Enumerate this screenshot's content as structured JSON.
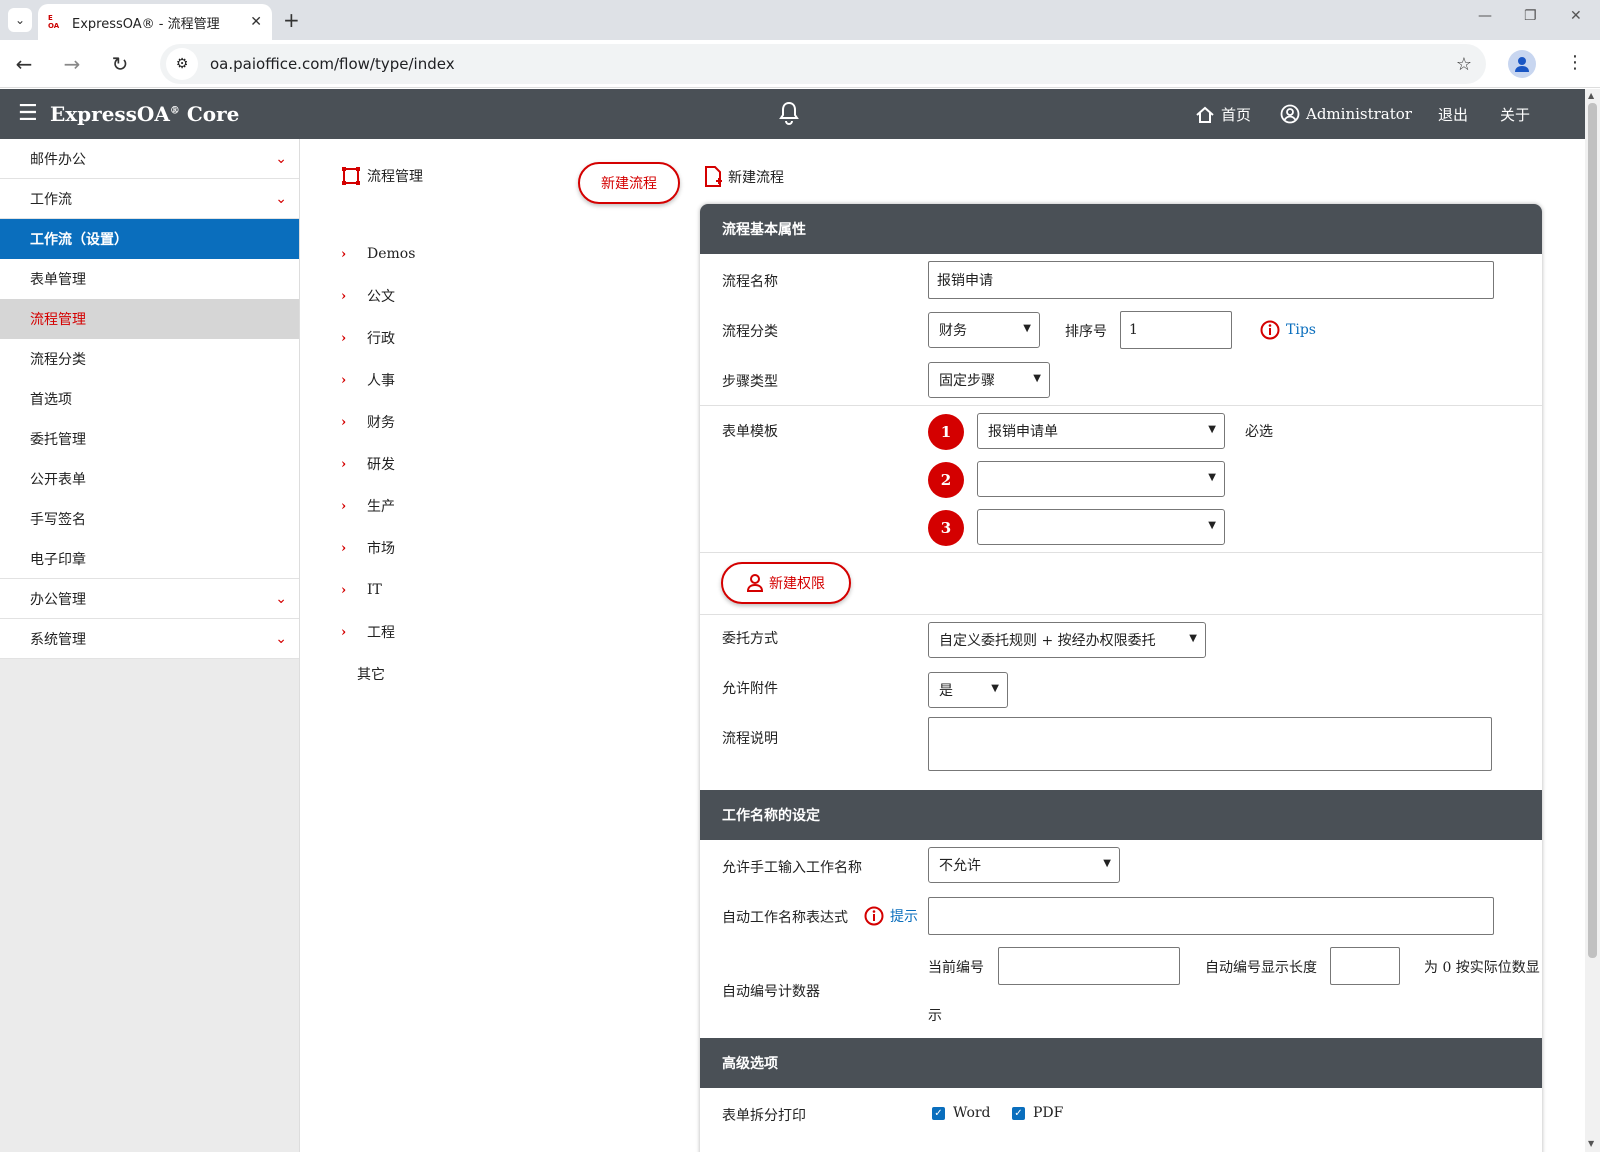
{
  "browser": {
    "tab_title": "ExpressOA® - 流程管理",
    "favicon_text": "E OA",
    "url": "oa.paioffice.com/flow/type/index"
  },
  "header": {
    "brand": "ExpressOA",
    "brand_mark": "®",
    "brand_suffix": " Core",
    "home": "首页",
    "user": "Administrator",
    "logout": "退出",
    "about": "关于"
  },
  "sidebar": {
    "groups_top": [
      {
        "label": "邮件办公"
      },
      {
        "label": "工作流"
      }
    ],
    "active": "工作流（设置）",
    "items": [
      {
        "label": "表单管理"
      },
      {
        "label": "流程管理"
      },
      {
        "label": "流程分类"
      },
      {
        "label": "首选项"
      },
      {
        "label": "委托管理"
      },
      {
        "label": "公开表单"
      },
      {
        "label": "手写签名"
      },
      {
        "label": "电子印章"
      }
    ],
    "groups_bottom": [
      {
        "label": "办公管理"
      },
      {
        "label": "系统管理"
      }
    ]
  },
  "tree": {
    "title": "流程管理",
    "new_button": "新建流程",
    "items": [
      "Demos",
      "公文",
      "行政",
      "人事",
      "财务",
      "研发",
      "生产",
      "市场",
      "IT",
      "工程"
    ],
    "other": "其它"
  },
  "form": {
    "title": "新建流程",
    "basic": {
      "heading": "流程基本属性",
      "name_label": "流程名称",
      "name_value": "报销申请",
      "category_label": "流程分类",
      "category_value": "财务",
      "order_label": "排序号",
      "order_value": "1",
      "tips": "Tips",
      "step_label": "步骤类型",
      "step_value": "固定步骤",
      "template_label": "表单模板",
      "templates": [
        {
          "num": "1",
          "value": "报销申请单"
        },
        {
          "num": "2",
          "value": ""
        },
        {
          "num": "3",
          "value": ""
        }
      ],
      "required": "必选",
      "new_permission": "新建权限",
      "delegate_label": "委托方式",
      "delegate_value": "自定义委托规则 + 按经办权限委托",
      "attach_label": "允许附件",
      "attach_value": "是",
      "desc_label": "流程说明",
      "desc_value": ""
    },
    "workname": {
      "heading": "工作名称的设定",
      "manual_label": "允许手工输入工作名称",
      "manual_value": "不允许",
      "expr_label": "自动工作名称表达式",
      "expr_hint": "提示",
      "expr_value": "",
      "counter_label": "自动编号计数器",
      "current_label": "当前编号",
      "current_value": "",
      "length_label": "自动编号显示长度",
      "length_value": "",
      "length_note_a": "为 0 按实际位数显",
      "length_note_b": "示"
    },
    "advanced": {
      "heading": "高级选项",
      "print_label": "表单拆分打印",
      "print_options": [
        "Word",
        "PDF"
      ]
    }
  },
  "colors": {
    "accent_red": "#d40000",
    "primary_blue": "#0a6ebd",
    "header_gray": "#4a5056"
  }
}
